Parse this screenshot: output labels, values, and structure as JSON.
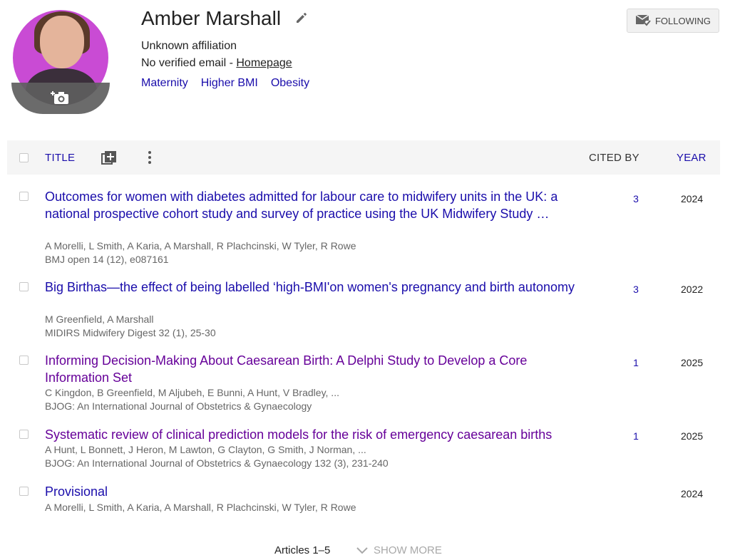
{
  "profile": {
    "name": "Amber Marshall",
    "affiliation": "Unknown affiliation",
    "email_text": "No verified email - ",
    "homepage_label": "Homepage",
    "interests": [
      "Maternity",
      "Higher BMI",
      "Obesity"
    ],
    "follow_label": "FOLLOWING"
  },
  "table": {
    "headers": {
      "title": "TITLE",
      "cited_by": "CITED BY",
      "year": "YEAR"
    },
    "rows": [
      {
        "title": "Outcomes for women with diabetes admitted for labour care to midwifery units in the UK: a national prospective cohort study and survey of practice using the UK Midwifery Study …",
        "authors": "A Morelli, L Smith, A Karia, A Marshall, R Plachcinski, W Tyler, R Rowe",
        "venue": "BMJ open 14 (12), e087161",
        "cited_by": "3",
        "year": "2024"
      },
      {
        "title": "Big Birthas—the effect of being labelled ‘high-BMI'on women's pregnancy and birth autonomy",
        "authors": "M Greenfield, A Marshall",
        "venue": "MIDIRS Midwifery Digest 32 (1), 25-30",
        "cited_by": "3",
        "year": "2022"
      },
      {
        "title": "Informing Decision-Making About Caesarean Birth: A Delphi Study to Develop a Core Information Set",
        "authors": "C Kingdon, B Greenfield, M Aljubeh, E Bunni, A Hunt, V Bradley, ...",
        "venue": "BJOG: An International Journal of Obstetrics & Gynaecology",
        "cited_by": "1",
        "year": "2025"
      },
      {
        "title": "Systematic review of clinical prediction models for the risk of emergency caesarean births",
        "authors": "A Hunt, L Bonnett, J Heron, M Lawton, G Clayton, G Smith, J Norman, ...",
        "venue": "BJOG: An International Journal of Obstetrics & Gynaecology 132 (3), 231-240",
        "cited_by": "1",
        "year": "2025"
      },
      {
        "title": "Provisional",
        "authors": "A Morelli, L Smith, A Karia, A Marshall, R Plachcinski, W Tyler, R Rowe",
        "venue": "",
        "cited_by": "",
        "year": "2024"
      }
    ]
  },
  "footer": {
    "articles": "Articles 1–5",
    "show_more": "SHOW MORE"
  },
  "colors": {
    "link": "#1a0dab",
    "visited": "#660099",
    "header_bg": "#f5f5f5"
  },
  "icons": [
    "edit-icon",
    "camera-icon",
    "mail-check-icon",
    "add-box-icon",
    "more-vert-icon",
    "chevron-down-icon"
  ]
}
